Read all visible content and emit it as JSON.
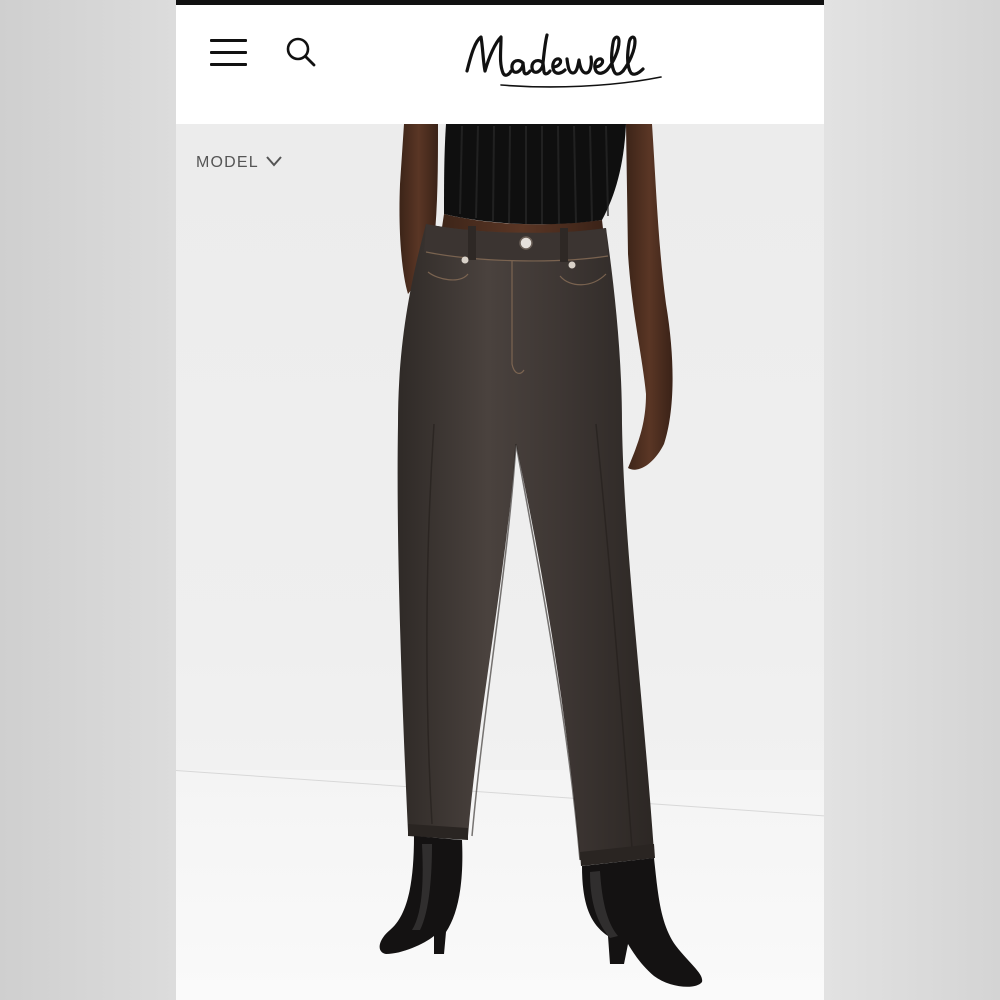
{
  "header": {
    "brand": "Madewell",
    "menu_icon": "hamburger-menu-icon",
    "search_icon": "search-icon"
  },
  "hero": {
    "model_toggle_label": "MODEL",
    "model_toggle_icon": "chevron-down-icon"
  },
  "colors": {
    "header_bg": "#ffffff",
    "top_strip": "#111111",
    "jeans": "#3a3431",
    "text": "#555555"
  }
}
